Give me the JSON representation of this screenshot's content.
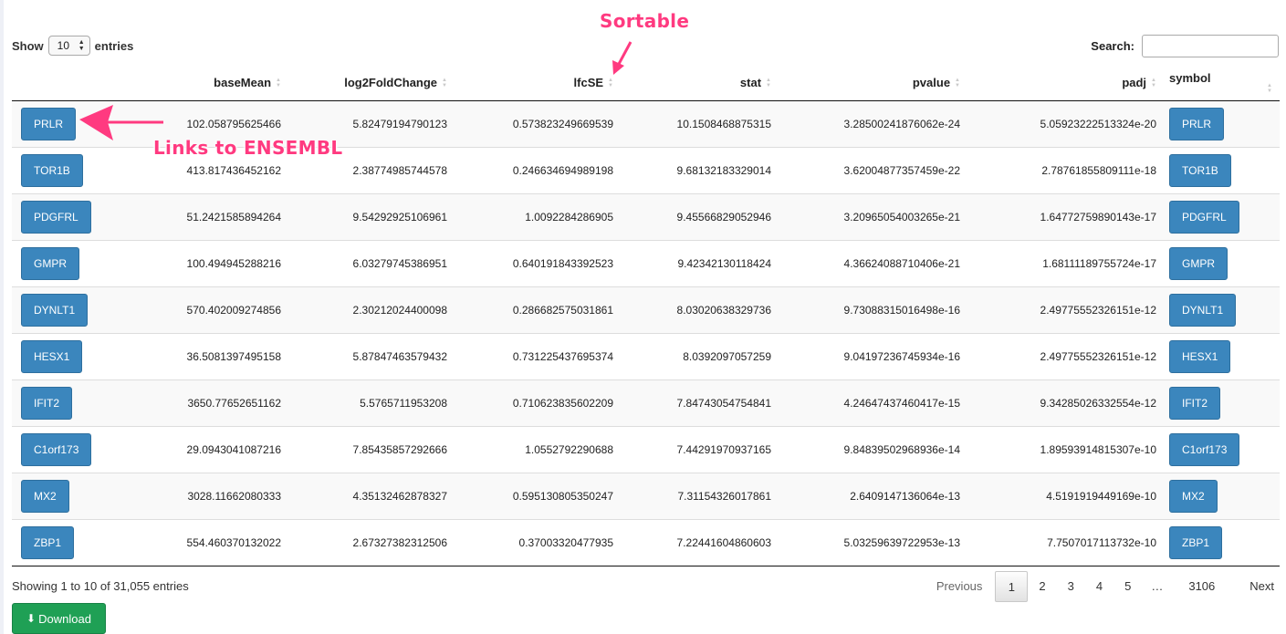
{
  "length_menu": {
    "show_label": "Show",
    "value": "10",
    "entries_label": "entries"
  },
  "search": {
    "label": "Search:",
    "value": ""
  },
  "annotations": {
    "sortable": "Sortable",
    "links": "Links to ENSEMBL",
    "color": "#ff3a80"
  },
  "columns": [
    "",
    "baseMean",
    "log2FoldChange",
    "lfcSE",
    "stat",
    "pvalue",
    "padj",
    "symbol"
  ],
  "rows": [
    {
      "gene": "PRLR",
      "baseMean": "102.058795625466",
      "log2FoldChange": "5.82479194790123",
      "lfcSE": "0.573823249669539",
      "stat": "10.1508468875315",
      "pvalue": "3.28500241876062e-24",
      "padj": "5.05923222513324e-20",
      "symbol": "PRLR"
    },
    {
      "gene": "TOR1B",
      "baseMean": "413.817436452162",
      "log2FoldChange": "2.38774985744578",
      "lfcSE": "0.246634694989198",
      "stat": "9.68132183329014",
      "pvalue": "3.62004877357459e-22",
      "padj": "2.78761855809111e-18",
      "symbol": "TOR1B"
    },
    {
      "gene": "PDGFRL",
      "baseMean": "51.2421585894264",
      "log2FoldChange": "9.54292925106961",
      "lfcSE": "1.0092284286905",
      "stat": "9.45566829052946",
      "pvalue": "3.20965054003265e-21",
      "padj": "1.64772759890143e-17",
      "symbol": "PDGFRL"
    },
    {
      "gene": "GMPR",
      "baseMean": "100.494945288216",
      "log2FoldChange": "6.03279745386951",
      "lfcSE": "0.640191843392523",
      "stat": "9.42342130118424",
      "pvalue": "4.36624088710406e-21",
      "padj": "1.68111189755724e-17",
      "symbol": "GMPR"
    },
    {
      "gene": "DYNLT1",
      "baseMean": "570.402009274856",
      "log2FoldChange": "2.30212024400098",
      "lfcSE": "0.286682575031861",
      "stat": "8.03020638329736",
      "pvalue": "9.73088315016498e-16",
      "padj": "2.49775552326151e-12",
      "symbol": "DYNLT1"
    },
    {
      "gene": "HESX1",
      "baseMean": "36.5081397495158",
      "log2FoldChange": "5.87847463579432",
      "lfcSE": "0.731225437695374",
      "stat": "8.0392097057259",
      "pvalue": "9.04197236745934e-16",
      "padj": "2.49775552326151e-12",
      "symbol": "HESX1"
    },
    {
      "gene": "IFIT2",
      "baseMean": "3650.77652651162",
      "log2FoldChange": "5.5765711953208",
      "lfcSE": "0.710623835602209",
      "stat": "7.84743054754841",
      "pvalue": "4.24647437460417e-15",
      "padj": "9.34285026332554e-12",
      "symbol": "IFIT2"
    },
    {
      "gene": "C1orf173",
      "baseMean": "29.0943041087216",
      "log2FoldChange": "7.85435857292666",
      "lfcSE": "1.0552792290688",
      "stat": "7.44291970937165",
      "pvalue": "9.84839502968936e-14",
      "padj": "1.89593914815307e-10",
      "symbol": "C1orf173"
    },
    {
      "gene": "MX2",
      "baseMean": "3028.11662080333",
      "log2FoldChange": "4.35132462878327",
      "lfcSE": "0.595130805350247",
      "stat": "7.31154326017861",
      "pvalue": "2.6409147136064e-13",
      "padj": "4.5191919449169e-10",
      "symbol": "MX2"
    },
    {
      "gene": "ZBP1",
      "baseMean": "554.460370132022",
      "log2FoldChange": "2.67327382312506",
      "lfcSE": "0.37003320477935",
      "stat": "7.22441604860603",
      "pvalue": "5.03259639722953e-13",
      "padj": "7.7507017113732e-10",
      "symbol": "ZBP1"
    }
  ],
  "info": "Showing 1 to 10 of 31,055 entries",
  "pagination": {
    "previous": "Previous",
    "pages": [
      "1",
      "2",
      "3",
      "4",
      "5"
    ],
    "ellipsis": "…",
    "last": "3106",
    "next": "Next",
    "current": "1"
  },
  "download": {
    "label": "Download",
    "icon": "download-icon"
  },
  "colors": {
    "gene_button": "#3b86bd",
    "download_button": "#1fa055",
    "annotation": "#ff3a80"
  }
}
